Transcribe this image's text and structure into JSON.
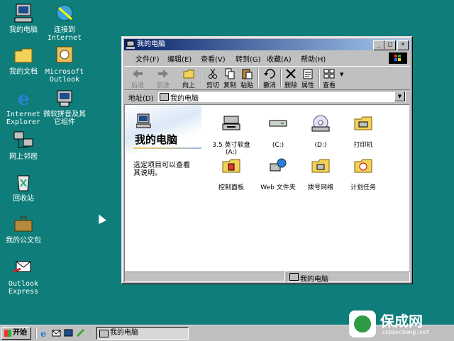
{
  "desktop": {
    "icons": [
      {
        "label": "我的电脑"
      },
      {
        "label": "连接到\nInternet"
      },
      {
        "label": "我的文档"
      },
      {
        "label": "Microsoft\nOutlook"
      },
      {
        "label": "Internet\nExplorer"
      },
      {
        "label": "微软拼音及其\n它组件"
      },
      {
        "label": "网上邻居"
      },
      {
        "label": "回收站"
      },
      {
        "label": "我的公文包"
      },
      {
        "label": "Outlook\nExpress"
      }
    ]
  },
  "window": {
    "title": "我的电脑",
    "menus": [
      "文件(F)",
      "编辑(E)",
      "查看(V)",
      "转到(G)",
      "收藏(A)",
      "帮助(H)"
    ],
    "toolbar": [
      "后退",
      "前进",
      "向上",
      "剪切",
      "复制",
      "粘贴",
      "撤消",
      "删除",
      "属性",
      "查看"
    ],
    "address_label": "地址(D)",
    "address_value": "我的电脑",
    "left_title": "我的电脑",
    "left_hint": "选定项目可以查看\n其说明。",
    "items": [
      {
        "label": "3.5 英寸软盘\n(A:)"
      },
      {
        "label": "(C:)"
      },
      {
        "label": "(D:)"
      },
      {
        "label": "打印机"
      },
      {
        "label": "控制面板"
      },
      {
        "label": "Web 文件夹"
      },
      {
        "label": "拨号网络"
      },
      {
        "label": "计划任务"
      }
    ],
    "status_text": "我的电脑"
  },
  "taskbar": {
    "start_label": "开始",
    "task_label": "我的电脑"
  },
  "watermark": {
    "title": "保成网",
    "url": "zsbaocheng.net"
  },
  "colors": {
    "desktop": "#0f7e7a",
    "titlebar_start": "#0a246a",
    "titlebar_end": "#a6caf0"
  }
}
